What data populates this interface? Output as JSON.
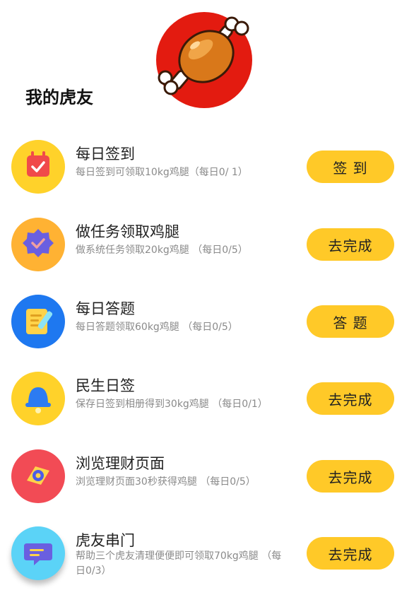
{
  "header": {
    "title": "我的虎友",
    "logo": "drumstick-logo"
  },
  "tasks": [
    {
      "title": "每日签到",
      "desc": "每日签到可领取10kg鸡腿（每日0/ 1）",
      "button": "签 到",
      "icon": "calendar-check-icon",
      "color": "#FFD22A"
    },
    {
      "title": "做任务领取鸡腿",
      "desc": "做系统任务领取20kg鸡腿 （每日0/5）",
      "button": "去完成",
      "icon": "badge-check-icon",
      "color": "#FFB233"
    },
    {
      "title": "每日答题",
      "desc": "每日答题领取60kg鸡腿 （每日0/5）",
      "button": "答 题",
      "icon": "quiz-edit-icon",
      "color": "#1E78F0"
    },
    {
      "title": "民生日签",
      "desc": "保存日签到相册得到30kg鸡腿 （每日0/1）",
      "button": "去完成",
      "icon": "bell-icon",
      "color": "#FFD22A"
    },
    {
      "title": "浏览理财页面",
      "desc": "浏览理财页面30秒获得鸡腿 （每日0/5）",
      "button": "去完成",
      "icon": "compass-icon",
      "color": "#F24B55"
    },
    {
      "title": "虎友串门",
      "desc": "帮助三个虎友清理便便即可领取70kg鸡腿 （每日0/3）",
      "button": "去完成",
      "icon": "chat-icon",
      "color": "#5BD3F7"
    }
  ]
}
